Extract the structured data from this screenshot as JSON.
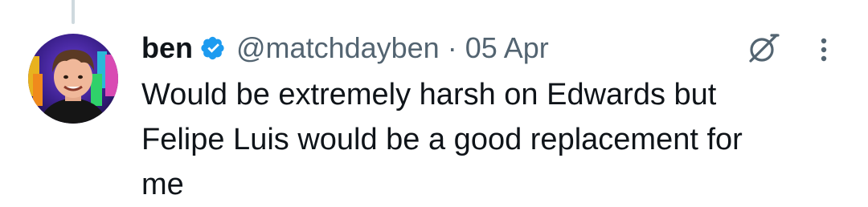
{
  "tweet": {
    "author": {
      "display_name": "ben",
      "handle": "@matchdayben",
      "verified": true
    },
    "separator": "·",
    "timestamp": "05 Apr",
    "text": "Would be extremely harsh on Edwards but\nFelipe Luis would be a good replacement for\nme"
  },
  "icons": {
    "verified": "verified-badge-icon",
    "grok": "grok-icon",
    "more": "more-options-icon"
  },
  "colors": {
    "text_primary": "#0f1419",
    "text_secondary": "#536471",
    "verified_blue": "#1d9bf0",
    "thread_line": "#cfd9de"
  }
}
